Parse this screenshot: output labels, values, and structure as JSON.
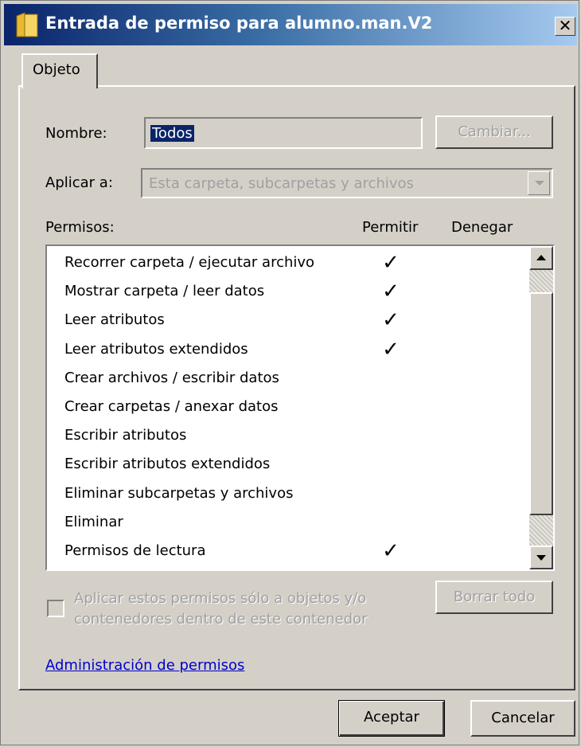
{
  "window": {
    "title": "Entrada de permiso para alumno.man.V2",
    "close_glyph": "✕"
  },
  "tabs": [
    {
      "label": "Objeto",
      "active": true
    }
  ],
  "name_field": {
    "label": "Nombre:",
    "value": "Todos",
    "change_button": "Cambiar..."
  },
  "apply_to": {
    "label": "Aplicar a:",
    "value": "Esta carpeta, subcarpetas y archivos"
  },
  "permissions": {
    "header": "Permisos:",
    "allow_header": "Permitir",
    "deny_header": "Denegar",
    "check_glyph": "✓",
    "rows": [
      {
        "name": "Recorrer carpeta / ejecutar archivo",
        "allow": true,
        "deny": false
      },
      {
        "name": "Mostrar carpeta / leer datos",
        "allow": true,
        "deny": false
      },
      {
        "name": "Leer atributos",
        "allow": true,
        "deny": false
      },
      {
        "name": "Leer atributos extendidos",
        "allow": true,
        "deny": false
      },
      {
        "name": "Crear archivos / escribir datos",
        "allow": false,
        "deny": false
      },
      {
        "name": "Crear carpetas / anexar datos",
        "allow": false,
        "deny": false
      },
      {
        "name": "Escribir atributos",
        "allow": false,
        "deny": false
      },
      {
        "name": "Escribir atributos extendidos",
        "allow": false,
        "deny": false
      },
      {
        "name": "Eliminar subcarpetas y archivos",
        "allow": false,
        "deny": false
      },
      {
        "name": "Eliminar",
        "allow": false,
        "deny": false
      },
      {
        "name": "Permisos de lectura",
        "allow": true,
        "deny": false
      }
    ]
  },
  "apply_only_checkbox": {
    "label": "Aplicar estos permisos sólo a objetos y/o contenedores dentro de este contenedor",
    "checked": false
  },
  "clear_all_button": "Borrar todo",
  "manage_link": "Administración de permisos",
  "footer": {
    "ok_button": "Aceptar",
    "cancel_button": "Cancelar"
  },
  "colors": {
    "title_bar_start": "#0a246a",
    "title_bar_end": "#a6caf0",
    "dialog_bg": "#d4d0c8",
    "link": "#0000cc",
    "selection": "#0a246a"
  }
}
